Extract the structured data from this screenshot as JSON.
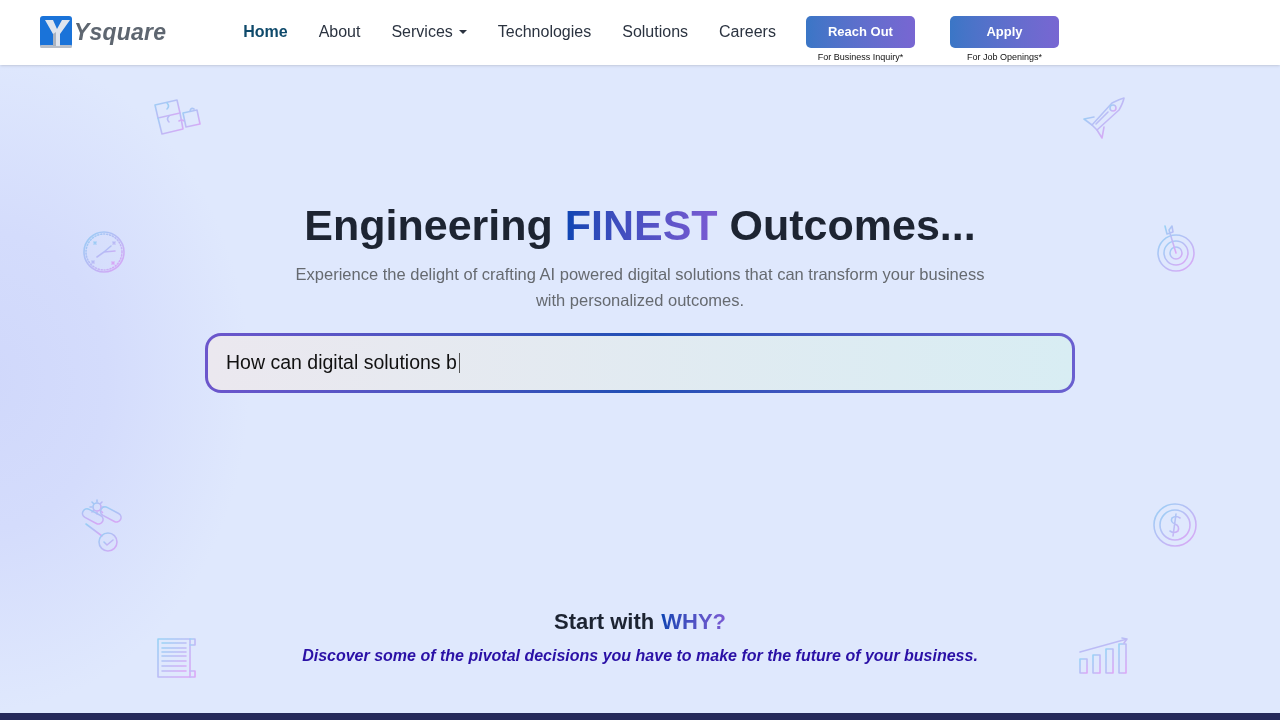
{
  "header": {
    "logo": {
      "text": "Ysquare"
    },
    "nav": [
      {
        "label": "Home",
        "selected": true,
        "dropdown": false
      },
      {
        "label": "About",
        "selected": false,
        "dropdown": false
      },
      {
        "label": "Services",
        "selected": false,
        "dropdown": true
      },
      {
        "label": "Technologies",
        "selected": false,
        "dropdown": false
      },
      {
        "label": "Solutions",
        "selected": false,
        "dropdown": false
      },
      {
        "label": "Careers",
        "selected": false,
        "dropdown": false
      }
    ],
    "actions": [
      {
        "label": "Reach Out",
        "caption": "For Business Inquiry*"
      },
      {
        "label": "Apply",
        "caption": "For Job Openings*"
      }
    ]
  },
  "hero": {
    "title": [
      {
        "text": "Engineering ",
        "highlight": false
      },
      {
        "text": "FINEST",
        "highlight": true
      },
      {
        "text": " Outcomes...",
        "highlight": false
      }
    ],
    "subtitle": "Experience the delight of crafting AI powered digital solutions that can transform your business with personalized outcomes.",
    "search": {
      "value": "How can digital solutions b"
    }
  },
  "why": {
    "title": [
      {
        "text": "Start with",
        "highlight": false
      },
      {
        "text": "WHY?",
        "highlight": true
      }
    ],
    "tagline": "Discover some of the pivotal decisions you have to make for the future of your business."
  }
}
